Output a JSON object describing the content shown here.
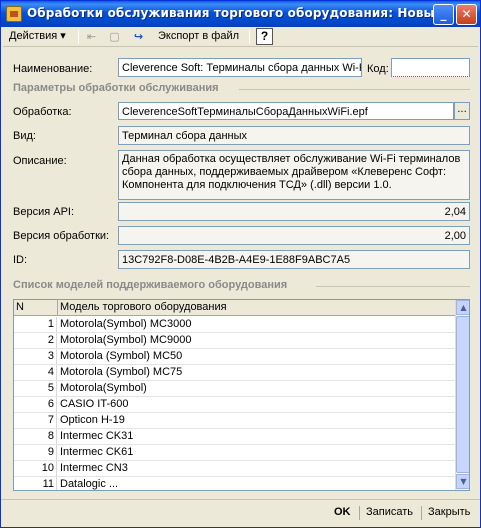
{
  "window": {
    "title": "Обработки обслуживания торгового оборудования: Новый *",
    "min_glyph": "_",
    "close_glyph": "✕"
  },
  "toolbar": {
    "actions_label": "Действия",
    "actions_arrow": "▾",
    "back_glyph": "⇤",
    "forward_glyph": "▢",
    "refresh_glyph": "↪",
    "export_label": "Экспорт в файл",
    "help_label": "?"
  },
  "form": {
    "name_label": "Наименование:",
    "name_value": "Cleverence Soft: Терминалы сбора данных Wi-Fi",
    "code_label": "Код:",
    "code_value": "",
    "params_section": "Параметры обработки обслуживания",
    "processing_label": "Обработка:",
    "processing_value": "CleverenceSoftТерминалыСбораДанныхWiFi.epf",
    "ellipsis": "...",
    "kind_label": "Вид:",
    "kind_value": "Терминал сбора данных",
    "desc_label": "Описание:",
    "desc_value": "Данная обработка осуществляет обслуживание Wi-Fi терминалов сбора данных, поддерживаемых драйвером «Клеверенс Софт: Компонента для подключения ТСД» (.dll) версии 1.0.",
    "api_label": "Версия API:",
    "api_value": "2,04",
    "ver_label": "Версия обработки:",
    "ver_value": "2,00",
    "id_label": "ID:",
    "id_value": "13C792F8-D08E-4B2B-A4E9-1E88F9ABC7A5",
    "models_section": "Список моделей поддерживаемого оборудования"
  },
  "table": {
    "headers": [
      "N",
      "Модель торгового оборудования"
    ],
    "rows": [
      {
        "n": "1",
        "model": "Motorola(Symbol) MC3000"
      },
      {
        "n": "2",
        "model": "Motorola(Symbol) MC9000"
      },
      {
        "n": "3",
        "model": "Motorola (Symbol) MC50"
      },
      {
        "n": "4",
        "model": "Motorola (Symbol) MC75"
      },
      {
        "n": "5",
        "model": "Motorola(Symbol)"
      },
      {
        "n": "6",
        "model": "CASIO IT-600"
      },
      {
        "n": "7",
        "model": "Opticon H-19"
      },
      {
        "n": "8",
        "model": "Intermec CK31"
      },
      {
        "n": "9",
        "model": "Intermec CK61"
      },
      {
        "n": "10",
        "model": "Intermec CN3"
      },
      {
        "n": "11",
        "model": "Datalogic ..."
      }
    ],
    "scroll_up": "▲",
    "scroll_down": "▼"
  },
  "buttons": {
    "ok": "OK",
    "save": "Записать",
    "close": "Закрыть"
  }
}
